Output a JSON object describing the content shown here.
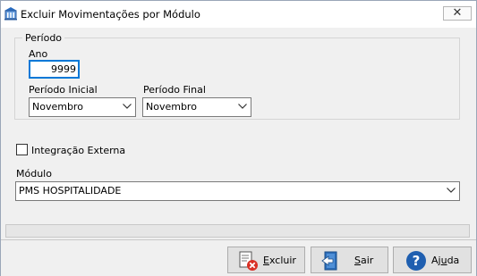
{
  "window": {
    "title": "Excluir Movimentações por Módulo",
    "icon": "building-icon",
    "close_symbol": "✕"
  },
  "periodo": {
    "caption": "Período",
    "ano_label": "Ano",
    "ano_value": "9999",
    "inicial_label": "Período Inicial",
    "inicial_value": "Novembro",
    "final_label": "Período Final",
    "final_value": "Novembro"
  },
  "integracao": {
    "label": "Integração Externa",
    "checked": false
  },
  "modulo": {
    "label": "Módulo",
    "value": "PMS HOSPITALIDADE"
  },
  "buttons": {
    "excluir": {
      "pre": "",
      "underlined": "E",
      "post": "xcluir",
      "icon": "delete-document-icon"
    },
    "sair": {
      "pre": "",
      "underlined": "S",
      "post": "air",
      "icon": "exit-door-icon"
    },
    "ajuda": {
      "pre": "Aj",
      "underlined": "u",
      "post": "da",
      "icon": "help-icon"
    }
  }
}
